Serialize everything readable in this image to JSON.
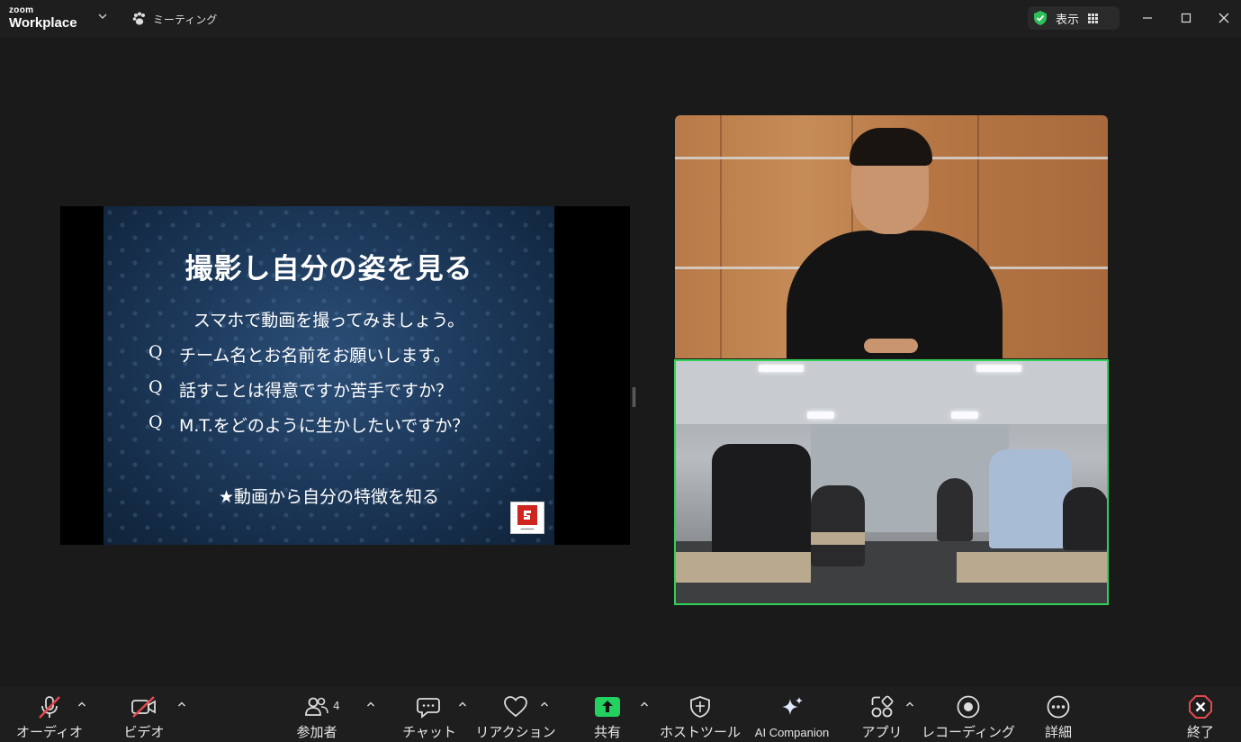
{
  "app": {
    "brand_small": "zoom",
    "brand_big": "Workplace",
    "meeting_label": "ミーティング",
    "view_label": "表示"
  },
  "colors": {
    "accent_green": "#2fd158",
    "end_red": "#e5484d",
    "share_green": "#23d160",
    "background": "#1a1a1a"
  },
  "slide": {
    "title": "撮影し自分の姿を見る",
    "subtitle": "スマホで動画を撮ってみましょう。",
    "questions": [
      {
        "mark": "Q",
        "text": "チーム名とお名前をお願いします。"
      },
      {
        "mark": "Q",
        "text": "話すことは得意ですか苦手ですか？"
      },
      {
        "mark": "Q",
        "text": "M.T.をどのように生かしたいですか？"
      }
    ],
    "footer": "★動画から自分の特徴を知る"
  },
  "toolbar": {
    "audio": "オーディオ",
    "video": "ビデオ",
    "participants": "参加者",
    "participants_count": "4",
    "chat": "チャット",
    "reaction": "リアクション",
    "share": "共有",
    "host_tools": "ホストツール",
    "ai_companion": "AI Companion",
    "apps": "アプリ",
    "recording": "レコーディング",
    "more": "詳細",
    "end": "終了"
  },
  "icons": {
    "audio": "microphone-muted-icon",
    "video": "camera-off-icon",
    "participants": "people-icon",
    "chat": "chat-bubble-icon",
    "reaction": "heart-icon",
    "share": "share-up-arrow-icon",
    "host_tools": "shield-icon",
    "ai_companion": "sparkle-icon",
    "apps": "apps-icon",
    "recording": "record-icon",
    "more": "more-icon",
    "end": "end-x-icon"
  }
}
